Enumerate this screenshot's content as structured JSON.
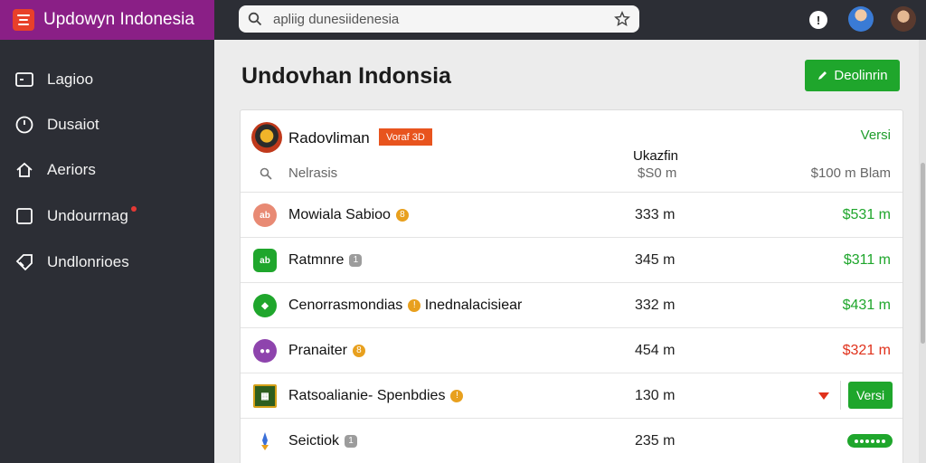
{
  "app": {
    "title": "Updowyn Indonesia"
  },
  "search": {
    "value": "apliig dunesiidenesia"
  },
  "sidebar": {
    "items": [
      {
        "label": "Lagioo",
        "icon": "inbox-icon"
      },
      {
        "label": "Dusaiot",
        "icon": "clock-icon"
      },
      {
        "label": "Aeriors",
        "icon": "home-icon"
      },
      {
        "label": "Undourrnag",
        "icon": "square-icon",
        "notification": true
      },
      {
        "label": "Undlonrioes",
        "icon": "tag-icon"
      }
    ]
  },
  "header": {
    "title": "Undovhan Indonsia",
    "primary_button": "Deolinrin"
  },
  "card": {
    "vendor_name": "Radovliman",
    "vendor_badge": "Voraf 3D",
    "versi_label": "Versi",
    "column_label": "Ukazfin",
    "filter_label": "Nelrasis",
    "mid_value": "$S0 m",
    "right_value": "$100 m Blam"
  },
  "rows": [
    {
      "name": "Mowiala Sabioo",
      "tag": "8",
      "value": "333 m",
      "price": "$531 m",
      "price_color": "green",
      "icon_color": "#e88a74",
      "icon_glyph": "ab",
      "icon_name": "app-icon-salmon"
    },
    {
      "name": "Ratmnre",
      "tag": "1",
      "tag_grey": true,
      "value": "345 m",
      "price": "$311 m",
      "price_color": "green",
      "icon_color": "#1fa62c",
      "icon_glyph": "ab",
      "icon_name": "app-icon-green"
    },
    {
      "name": "Cenorrasmondias",
      "tag": "!",
      "name_suffix": "Inednalacisiear",
      "value": "332 m",
      "price": "$431 m",
      "price_color": "green",
      "icon_color": "#1fa62c",
      "icon_glyph": "◆",
      "icon_name": "app-icon-green-tree"
    },
    {
      "name": "Pranaiter",
      "tag": "8",
      "value": "454 m",
      "price": "$321 m",
      "price_color": "red",
      "icon_color": "#8e44ad",
      "icon_glyph": "●●",
      "icon_name": "app-icon-purple"
    },
    {
      "name": "Ratsoalianie- Spenbdies",
      "tag": "!",
      "value": "130 m",
      "price": "",
      "price_color": "green",
      "icon_color": "#2e5e1e",
      "icon_glyph": "▦",
      "icon_name": "app-icon-film",
      "action_button": "Versi"
    },
    {
      "name": "Seictiok",
      "tag": "1",
      "tag_grey": true,
      "value": "235 m",
      "price": "",
      "price_color": "green",
      "icon_color": "#ffffff",
      "icon_glyph": "",
      "icon_name": "app-icon-rocket",
      "pill": true
    }
  ],
  "colors": {
    "accent": "#1fa62c",
    "brand": "#8a1f86",
    "sidebar": "#2c2e35",
    "danger": "#e0311b"
  }
}
